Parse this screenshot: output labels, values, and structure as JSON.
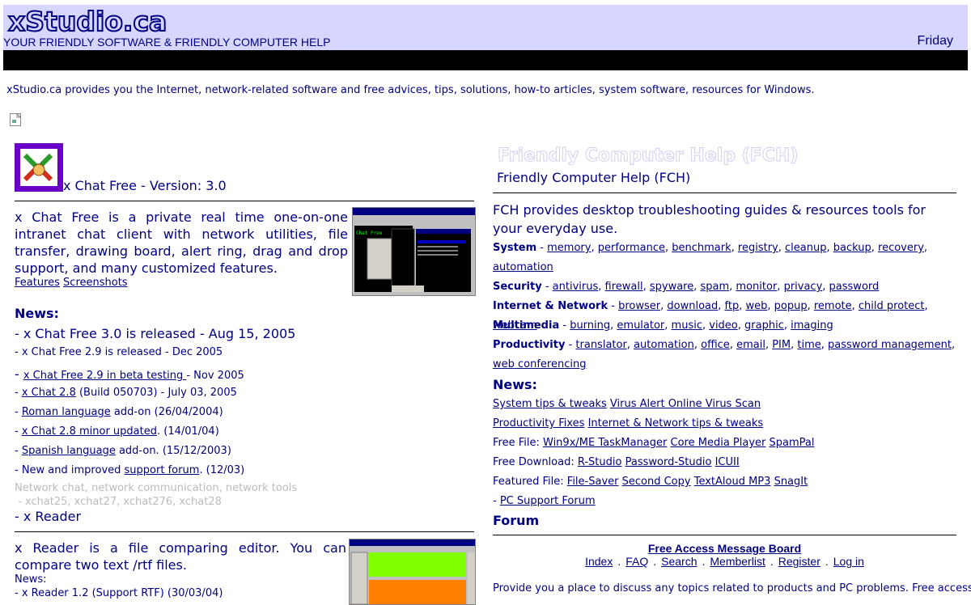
{
  "header": {
    "logo": "xStudio.ca",
    "tagline": "YOUR FRIENDLY SOFTWARE & FRIENDLY COMPUTER HELP",
    "day": "Friday"
  },
  "intro": "xStudio.ca provides you the Internet, network-related software and free advices, tips, solutions, how-to articles, system software, resources for Windows.",
  "left": {
    "product_title": "x Chat Free - Version: 3.0",
    "description": "x Chat Free is a private real time  one-on-one intranet chat client with network utilities, file transfer, drawing board, alert ring, drag and drop support, and many customized features.",
    "links": [
      "Features",
      "Screenshots"
    ],
    "news_heading": "News:",
    "news_big": "- x Chat Free 3.0 is released - Aug 15, 2005",
    "news": [
      {
        "pre": "- x Chat Free 2.9 is released - Dec 2005",
        "link": "",
        "post": ""
      },
      {
        "pre": "- ",
        "link": "x Chat Free 2.9 in beta testing ",
        "post": "- Nov 2005"
      },
      {
        "pre": "- ",
        "link": "x Chat 2.8",
        "post": " (Build 050703) - July 03, 2005"
      },
      {
        "pre": "- ",
        "link": "Roman language",
        "post": " add-on (26/04/2004)"
      },
      {
        "pre": "- ",
        "link": "x Chat 2.8 minor updated",
        "post": ". (14/01/04)"
      },
      {
        "pre": "- ",
        "link": "Spanish language",
        "post": " add-on. (15/12/2003)"
      },
      {
        "pre": "- New and improved ",
        "link": "support forum",
        "post": ". (12/03)"
      }
    ],
    "grey_line1": "Network chat, network communication, network tools",
    "grey_line2": " - xchat25, xchat27, xchat276, xchat28",
    "xreader_title": "- x Reader",
    "xreader_desc": "x Reader is a file comparing editor. You can compare two text /rtf files.",
    "xreader_news_label": "News:",
    "xreader_news1": "- x Reader 1.2 (Support RTF) (30/03/04)"
  },
  "right": {
    "fch_outline": "Friendly Computer Help (FCH)",
    "fch_title": "Friendly Computer Help (FCH)",
    "fch_desc": "FCH provides desktop troubleshooting guides &  resources tools for your everyday use.",
    "categories": [
      {
        "name": "System",
        "links": [
          "memory",
          "performance",
          "benchmark",
          "registry",
          "cleanup",
          "backup",
          "recovery",
          "automation"
        ]
      },
      {
        "name": "Security",
        "links": [
          "antivirus",
          "firewall",
          "spyware",
          "spam",
          "monitor",
          "privacy",
          "password"
        ]
      },
      {
        "name": "Internet & Network",
        "links": [
          "browser",
          "download",
          "ftp",
          "web",
          "popup",
          "remote",
          "child protect",
          "webcam"
        ]
      },
      {
        "name": "Multimedia",
        "links": [
          "burning",
          "emulator",
          "music",
          "video",
          "graphic",
          "imaging"
        ]
      },
      {
        "name": "Productivity",
        "links": [
          "translator",
          "automation",
          "office",
          "email",
          "PIM",
          "time",
          "password management",
          "web conferencing"
        ]
      }
    ],
    "news_heading": "News:",
    "news_row1": [
      "System tips & tweaks",
      "Virus Alert ",
      "Online Virus Scan"
    ],
    "news_row2": [
      "Productivity Fixes",
      "Internet & Network tips & tweaks"
    ],
    "free_file_label": "Free File: ",
    "free_file": [
      "Win9x/ME TaskManager",
      "Core Media Player",
      "SpamPal"
    ],
    "free_download_label": "Free Download: ",
    "free_download": [
      "R-Studio",
      "Password-Studio",
      "ICUII"
    ],
    "featured_label": "Featured File: ",
    "featured": [
      "File-Saver",
      "Second Copy",
      "TextAloud MP3",
      "SnagIt"
    ],
    "pc_support_prefix": "- ",
    "pc_support": "PC Support Forum",
    "forum_heading": "Forum",
    "fam_title": "Free Access Message Board",
    "fam_links": [
      "Index",
      "FAQ",
      "Search",
      "Memberlist",
      "Register",
      "Log in"
    ],
    "provide": "Provide you a place to discuss any topics related to products and PC problems.  Free access"
  }
}
